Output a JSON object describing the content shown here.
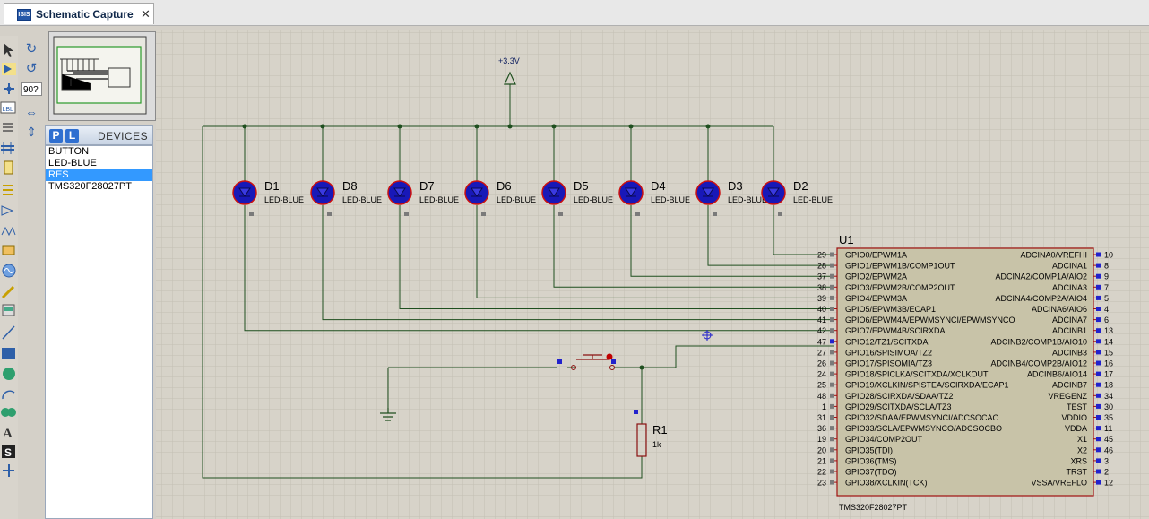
{
  "window": {
    "tab_title": "Schematic Capture",
    "tab_icon": "ISIS",
    "close_glyph": "✕"
  },
  "toolbar": {
    "rotation_angle": "90?"
  },
  "devices": {
    "header_label": "DEVICES",
    "p_label": "P",
    "l_label": "L",
    "items": [
      "BUTTON",
      "LED-BLUE",
      "RES",
      "TMS320F28027PT"
    ],
    "selected_index": 2
  },
  "schematic": {
    "power": {
      "label": "+3.3V"
    },
    "leds": [
      {
        "ref": "D1",
        "value": "LED-BLUE"
      },
      {
        "ref": "D8",
        "value": "LED-BLUE"
      },
      {
        "ref": "D7",
        "value": "LED-BLUE"
      },
      {
        "ref": "D6",
        "value": "LED-BLUE"
      },
      {
        "ref": "D5",
        "value": "LED-BLUE"
      },
      {
        "ref": "D4",
        "value": "LED-BLUE"
      },
      {
        "ref": "D3",
        "value": "LED-BLUE"
      },
      {
        "ref": "D2",
        "value": "LED-BLUE"
      }
    ],
    "resistor": {
      "ref": "R1",
      "value": "1k"
    },
    "ic": {
      "ref": "U1",
      "part": "TMS320F28027PT",
      "left_pins": [
        {
          "num": "29",
          "name": "GPIO0/EPWM1A"
        },
        {
          "num": "28",
          "name": "GPIO1/EPWM1B/COMP1OUT"
        },
        {
          "num": "37",
          "name": "GPIO2/EPWM2A"
        },
        {
          "num": "38",
          "name": "GPIO3/EPWM2B/COMP2OUT"
        },
        {
          "num": "39",
          "name": "GPIO4/EPWM3A"
        },
        {
          "num": "40",
          "name": "GPIO5/EPWM3B/ECAP1"
        },
        {
          "num": "41",
          "name": "GPIO6/EPWM4A/EPWMSYNCI/EPWMSYNCO"
        },
        {
          "num": "42",
          "name": "GPIO7/EPWM4B/SCIRXDA"
        },
        {
          "num": "47",
          "name": "GPIO12/TZ1/SCITXDA"
        },
        {
          "num": "27",
          "name": "GPIO16/SPISIMOA/TZ2"
        },
        {
          "num": "26",
          "name": "GPIO17/SPISOMIA/TZ3"
        },
        {
          "num": "24",
          "name": "GPIO18/SPICLKA/SCITXDA/XCLKOUT"
        },
        {
          "num": "25",
          "name": "GPIO19/XCLKIN/SPISTEA/SCIRXDA/ECAP1"
        },
        {
          "num": "48",
          "name": "GPIO28/SCIRXDA/SDAA/TZ2"
        },
        {
          "num": "1",
          "name": "GPIO29/SCITXDA/SCLA/TZ3"
        },
        {
          "num": "31",
          "name": "GPIO32/SDAA/EPWMSYNCI/ADCSOCAO"
        },
        {
          "num": "36",
          "name": "GPIO33/SCLA/EPWMSYNCO/ADCSOCBO"
        },
        {
          "num": "19",
          "name": "GPIO34/COMP2OUT"
        },
        {
          "num": "20",
          "name": "GPIO35(TDI)"
        },
        {
          "num": "21",
          "name": "GPIO36(TMS)"
        },
        {
          "num": "22",
          "name": "GPIO37(TDO)"
        },
        {
          "num": "23",
          "name": "GPIO38/XCLKIN(TCK)"
        }
      ],
      "right_pins": [
        {
          "num": "10",
          "name": "ADCINA0/VREFHI"
        },
        {
          "num": "8",
          "name": "ADCINA1"
        },
        {
          "num": "9",
          "name": "ADCINA2/COMP1A/AIO2"
        },
        {
          "num": "7",
          "name": "ADCINA3"
        },
        {
          "num": "5",
          "name": "ADCINA4/COMP2A/AIO4"
        },
        {
          "num": "4",
          "name": "ADCINA6/AIO6"
        },
        {
          "num": "6",
          "name": "ADCINA7"
        },
        {
          "num": "13",
          "name": "ADCINB1"
        },
        {
          "num": "14",
          "name": "ADCINB2/COMP1B/AIO10"
        },
        {
          "num": "15",
          "name": "ADCINB3"
        },
        {
          "num": "16",
          "name": "ADCINB4/COMP2B/AIO12"
        },
        {
          "num": "17",
          "name": "ADCINB6/AIO14"
        },
        {
          "num": "18",
          "name": "ADCINB7"
        },
        {
          "num": "34",
          "name": "VREGENZ"
        },
        {
          "num": "30",
          "name": "TEST"
        },
        {
          "num": "35",
          "name": "VDDIO"
        },
        {
          "num": "11",
          "name": "VDDA"
        },
        {
          "num": "45",
          "name": "X1"
        },
        {
          "num": "46",
          "name": "X2"
        },
        {
          "num": "3",
          "name": "XRS"
        },
        {
          "num": "2",
          "name": "TRST"
        },
        {
          "num": "12",
          "name": "VSSA/VREFLO"
        }
      ]
    }
  },
  "colors": {
    "canvas_bg": "#d7d3c9",
    "grid": "#c3bfb4",
    "wire": "#1f4f1f",
    "led_fill": "#1818b8",
    "led_ring": "#cc1010",
    "ic_body": "#c8c3a8",
    "ic_border": "#a01010",
    "label_text": "#102060"
  }
}
